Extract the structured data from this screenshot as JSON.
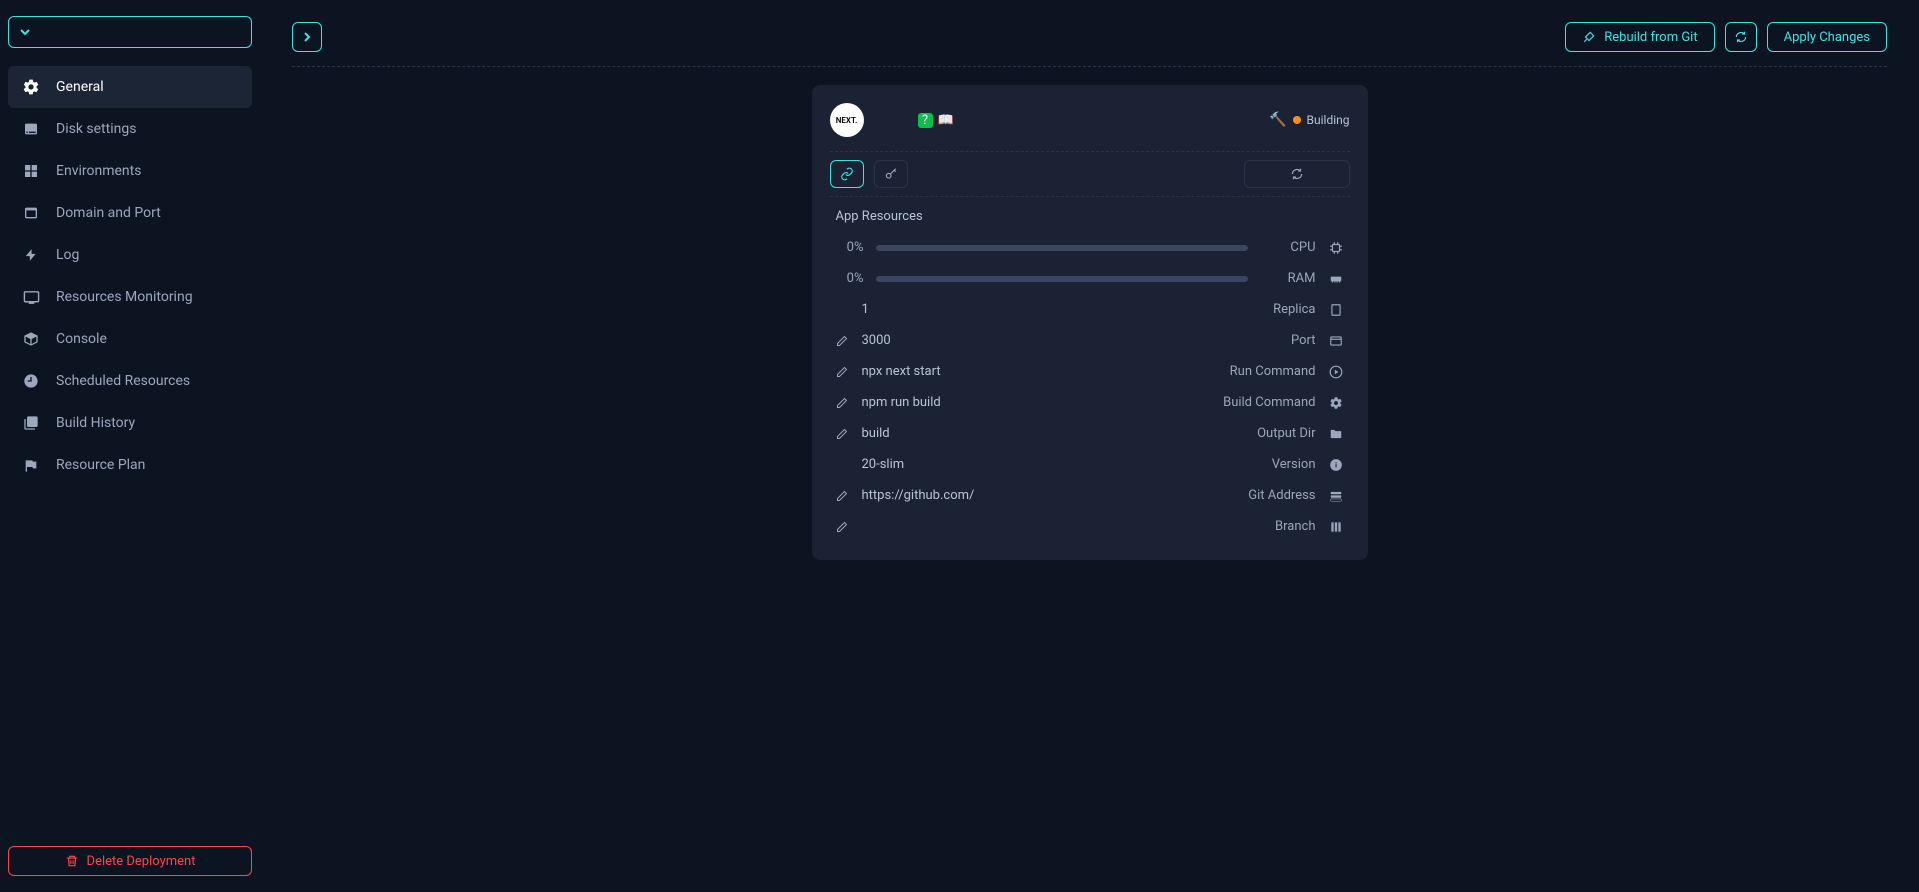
{
  "sidebar": {
    "items": [
      {
        "label": "General",
        "icon": "gear"
      },
      {
        "label": "Disk settings",
        "icon": "disk"
      },
      {
        "label": "Environments",
        "icon": "columns"
      },
      {
        "label": "Domain and Port",
        "icon": "window"
      },
      {
        "label": "Log",
        "icon": "bolt"
      },
      {
        "label": "Resources Monitoring",
        "icon": "monitor"
      },
      {
        "label": "Console",
        "icon": "cube"
      },
      {
        "label": "Scheduled Resources",
        "icon": "clock"
      },
      {
        "label": "Build History",
        "icon": "book"
      },
      {
        "label": "Resource Plan",
        "icon": "flag"
      }
    ],
    "delete_label": "Delete Deployment"
  },
  "topbar": {
    "rebuild_label": "Rebuild from Git",
    "apply_label": "Apply Changes"
  },
  "card": {
    "logo_text": "NEXT.",
    "status_label": "Building",
    "section_title": "App Resources",
    "cpu_value": "0%",
    "cpu_label": "CPU",
    "ram_value": "0%",
    "ram_label": "RAM",
    "replica_value": "1",
    "replica_label": "Replica",
    "port_value": "3000",
    "port_label": "Port",
    "run_cmd_value": "npx next start",
    "run_cmd_label": "Run Command",
    "build_cmd_value": "npm run build",
    "build_cmd_label": "Build Command",
    "output_dir_value": "build",
    "output_dir_label": "Output Dir",
    "version_value": "20-slim",
    "version_label": "Version",
    "git_value": "https://github.com/",
    "git_label": "Git Address",
    "branch_value": "",
    "branch_label": "Branch"
  }
}
